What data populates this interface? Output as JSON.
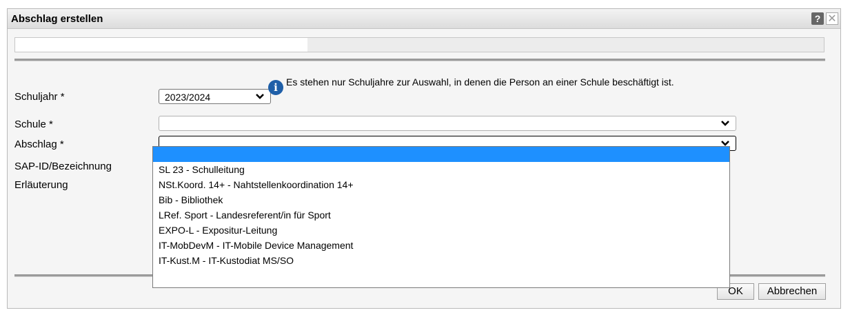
{
  "dialog": {
    "title": "Abschlag erstellen",
    "help_icon": "help-icon",
    "help_glyph": "?",
    "close_icon": "close-icon",
    "close_glyph": "✕"
  },
  "form": {
    "schuljahr": {
      "label": "Schuljahr *",
      "value": "2023/2024"
    },
    "info_glyph": "i",
    "hint": "Es stehen nur Schuljahre zur Auswahl, in denen die Person an einer Schule beschäftigt ist.",
    "schule": {
      "label": "Schule *",
      "value": ""
    },
    "abschlag": {
      "label": "Abschlag *",
      "value": ""
    },
    "sap_label": "SAP-ID/Bezeichnung",
    "erlaeuterung_label": "Erläuterung"
  },
  "dropdown": {
    "options": [
      "",
      "SL 23 - Schulleitung",
      "NSt.Koord. 14+ - Nahtstellenkoordination 14+",
      "Bib - Bibliothek",
      "LRef. Sport - Landesreferent/in für Sport",
      "EXPO-L - Expositur-Leitung",
      "IT-MobDevM - IT-Mobile Device Management",
      "IT-Kust.M - IT-Kustodiat MS/SO"
    ],
    "selected_index": 0,
    "highlight_color": "#1e90ff"
  },
  "buttons": {
    "ok": "OK",
    "cancel": "Abbrechen"
  }
}
